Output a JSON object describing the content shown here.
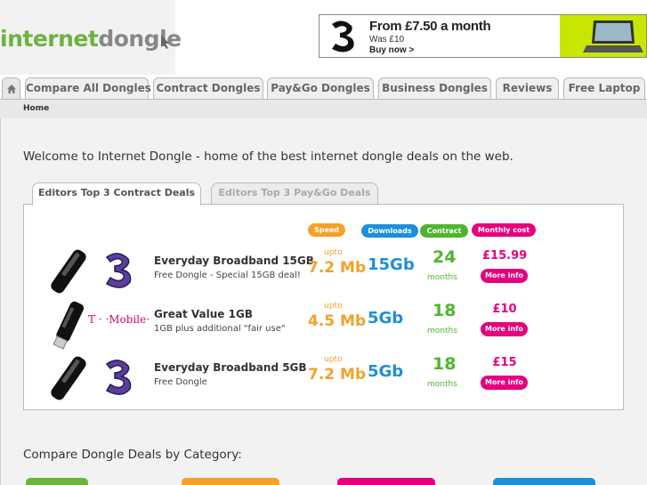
{
  "header": {
    "logo": {
      "part1": "internet",
      "part2": "dongle"
    },
    "banner": {
      "title": "From £7.50 a month",
      "was": "Was £10",
      "cta": "Buy now >"
    }
  },
  "nav": {
    "home_icon": "home-icon",
    "tabs": [
      "Compare All Dongles",
      "Contract Dongles",
      "Pay&Go Dongles",
      "Business Dongles",
      "Reviews",
      "Free Laptop"
    ]
  },
  "breadcrumb": "Home",
  "welcome": "Welcome to Internet Dongle - home of the best internet dongle deals on the web.",
  "deal_tabs": {
    "active": "Editors Top 3 Contract Deals",
    "inactive": "Editors Top 3 Pay&Go Deals"
  },
  "columns": {
    "speed": "Speed",
    "downloads": "Downloads",
    "contract": "Contract",
    "monthly": "Monthly cost"
  },
  "deals": [
    {
      "network": "three",
      "name": "Everyday Broadband 15GB",
      "desc": "Free Dongle - Special 15GB deal!",
      "upto": "upto",
      "speed": "7.2 Mb",
      "downloads": "15Gb",
      "contract": "24",
      "months": "months",
      "price": "£15.99",
      "more": "More info"
    },
    {
      "network": "T · ·Mobile·",
      "name": "Great Value 1GB",
      "desc": "1GB plus additional \"fair use\"",
      "upto": "upto",
      "speed": "4.5 Mb",
      "downloads": "5Gb",
      "contract": "18",
      "months": "months",
      "price": "£10",
      "more": "More info"
    },
    {
      "network": "three",
      "name": "Everyday Broadband 5GB",
      "desc": "Free Dongle",
      "upto": "upto",
      "speed": "7.2 Mb",
      "downloads": "5Gb",
      "contract": "18",
      "months": "months",
      "price": "£15",
      "more": "More info"
    }
  ],
  "compare_heading": "Compare Dongle Deals by Category:",
  "colors": {
    "green": "#6db33f",
    "orange": "#f3a12a",
    "blue": "#1e8fd8",
    "contract_green": "#4fb52f",
    "pink": "#e6007e"
  }
}
